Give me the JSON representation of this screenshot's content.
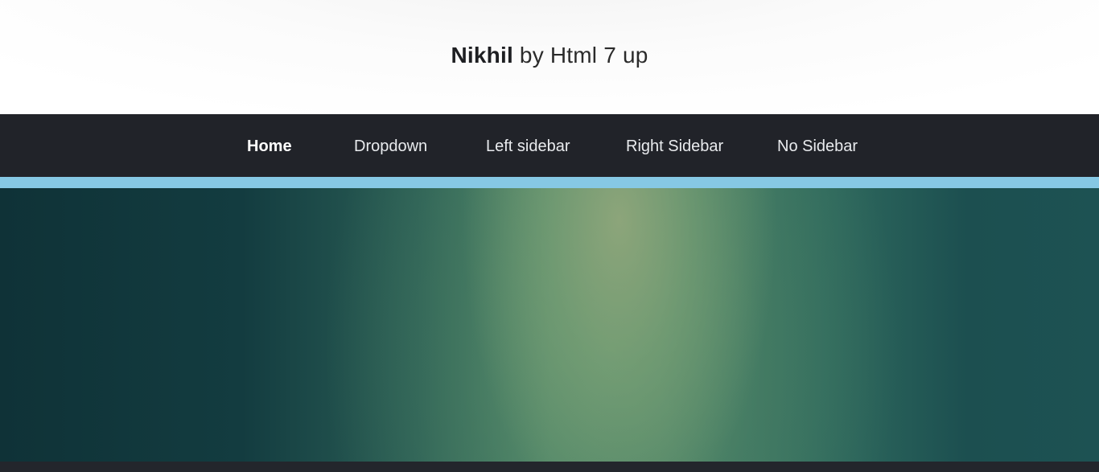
{
  "site": {
    "title_bold": "Nikhil",
    "title_rest": "by Html 7 up"
  },
  "nav": {
    "items": [
      {
        "label": "Home",
        "active": true
      },
      {
        "label": "Dropdown",
        "active": false
      },
      {
        "label": "Left sidebar",
        "active": false
      },
      {
        "label": "Right Sidebar",
        "active": false
      },
      {
        "label": "No Sidebar",
        "active": false
      }
    ]
  },
  "colors": {
    "nav_background": "#212329",
    "accent_bar": "#86c8e4",
    "banner_dark": "#0f3237",
    "banner_light": "#8faa7e"
  }
}
